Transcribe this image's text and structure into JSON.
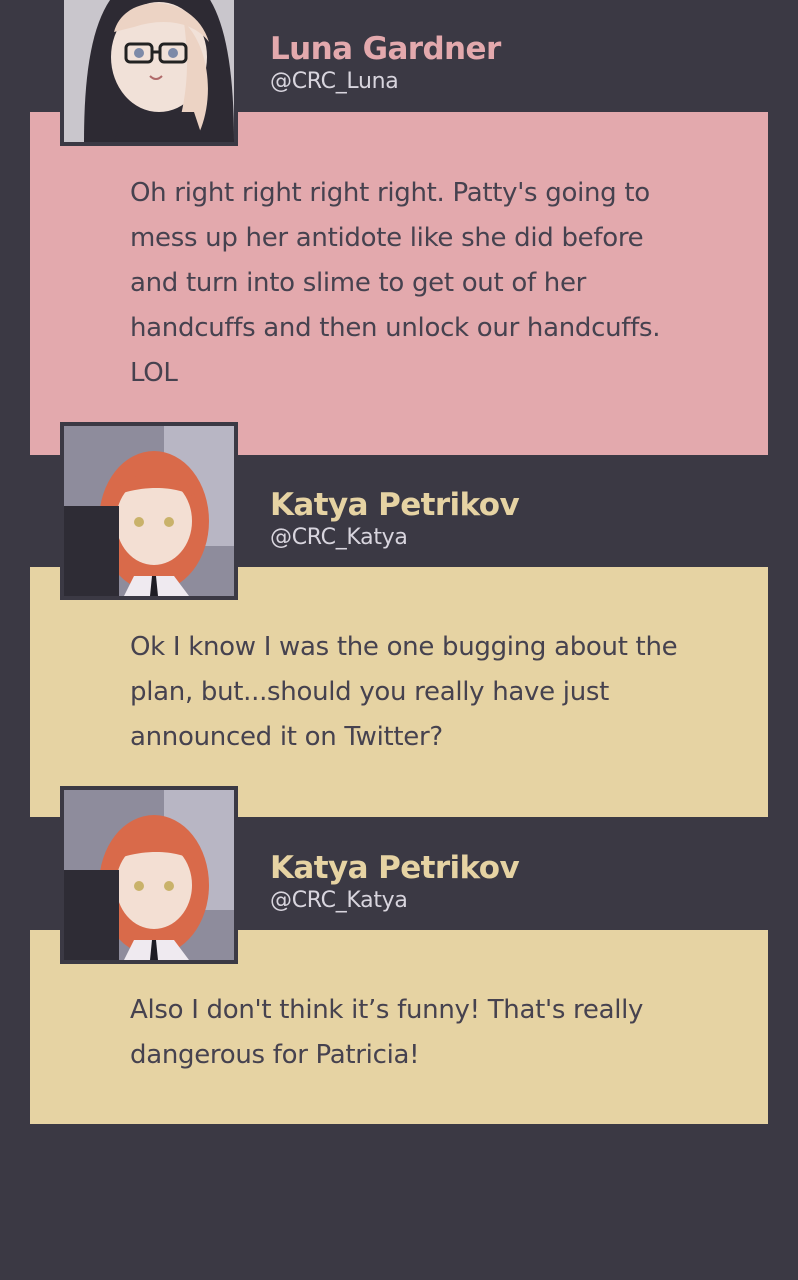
{
  "posts": [
    {
      "name": "Luna Gardner",
      "handle": "@CRC_Luna",
      "message": "Oh right right right right. Patty's going to mess up her antidote like she did before and turn into slime to get out of her handcuffs and then unlock our handcuffs. LOL",
      "card_color": "#e3a9ad"
    },
    {
      "name": "Katya Petrikov",
      "handle": "@CRC_Katya",
      "message": "Ok I know I was the one bugging about the plan, but...should you really have just announced it on Twitter?",
      "card_color": "#e6d3a3"
    },
    {
      "name": "Katya Petrikov",
      "handle": "@CRC_Katya",
      "message": "Also I don't think it’s funny! That's really dangerous for Patricia!",
      "card_color": "#e6d3a3"
    }
  ],
  "background_color": "#3b3944"
}
